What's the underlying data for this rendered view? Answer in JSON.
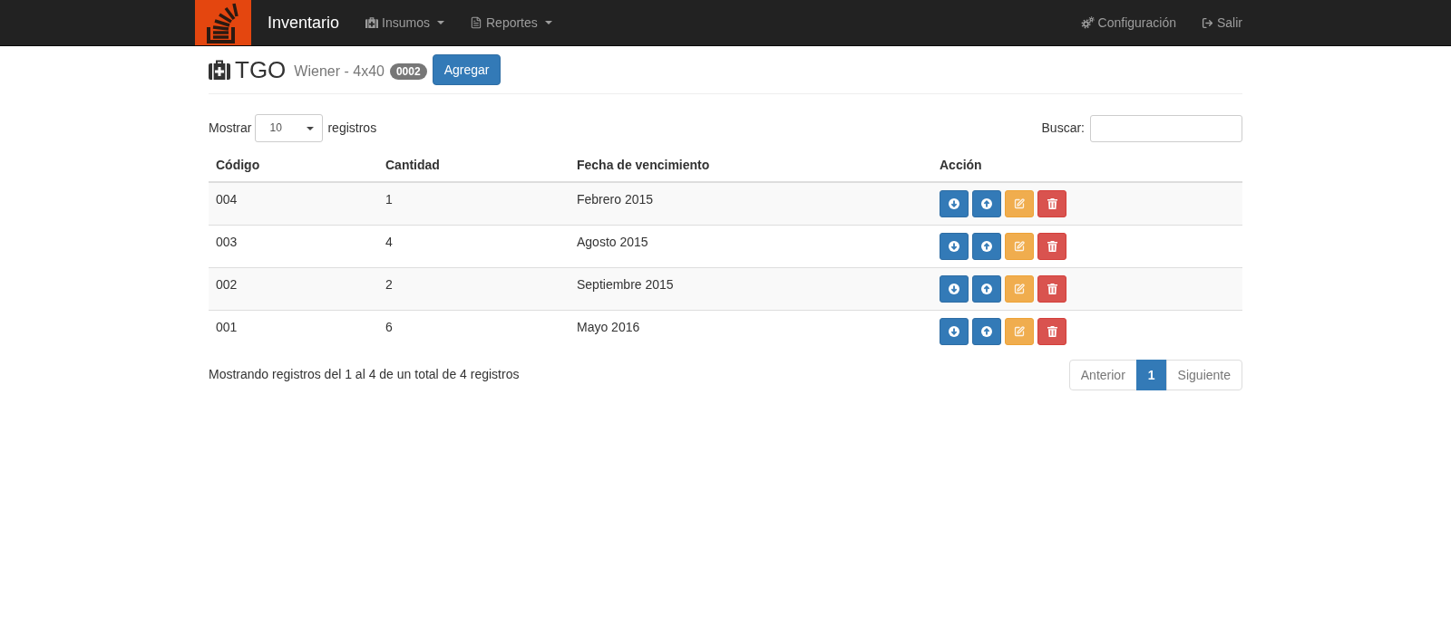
{
  "navbar": {
    "brand": "Inventario",
    "left_items": [
      {
        "label": "Insumos",
        "kind": "dropdown"
      },
      {
        "label": "Reportes",
        "kind": "dropdown"
      }
    ],
    "right_items": [
      {
        "label": "Configuración",
        "kind": "link"
      },
      {
        "label": "Salir",
        "kind": "link"
      }
    ]
  },
  "header": {
    "title": "TGO",
    "subtitle": "Wiener - 4x40",
    "badge": "0002",
    "button": "Agregar"
  },
  "length_menu": {
    "label_before": "Mostrar",
    "value": "10",
    "label_after": "registros"
  },
  "search": {
    "label": "Buscar:"
  },
  "table": {
    "columns": [
      "Código",
      "Cantidad",
      "Fecha de vencimiento",
      "Acción"
    ],
    "rows": [
      {
        "cells": [
          "004",
          "1",
          "Febrero 2015"
        ],
        "actions": [
          {
            "kind": "down"
          },
          {
            "kind": "up"
          },
          {
            "kind": "edit"
          },
          {
            "kind": "delete"
          }
        ]
      },
      {
        "cells": [
          "003",
          "4",
          "Agosto 2015"
        ],
        "actions": [
          {
            "kind": "down"
          },
          {
            "kind": "up"
          },
          {
            "kind": "edit"
          },
          {
            "kind": "delete"
          }
        ]
      },
      {
        "cells": [
          "002",
          "2",
          "Septiembre 2015"
        ],
        "actions": [
          {
            "kind": "down"
          },
          {
            "kind": "up"
          },
          {
            "kind": "edit"
          },
          {
            "kind": "delete"
          }
        ]
      },
      {
        "cells": [
          "001",
          "6",
          "Mayo 2016"
        ],
        "actions": [
          {
            "kind": "down"
          },
          {
            "kind": "up"
          },
          {
            "kind": "edit"
          },
          {
            "kind": "delete"
          }
        ]
      }
    ]
  },
  "info": "Mostrando registros del 1 al 4 de un total de 4 registros",
  "pagination": {
    "previous": {
      "label": "Anterior",
      "disabled": true
    },
    "pages": [
      {
        "label": "1",
        "selected": true
      }
    ],
    "next": {
      "label": "Siguiente",
      "disabled": true
    }
  }
}
